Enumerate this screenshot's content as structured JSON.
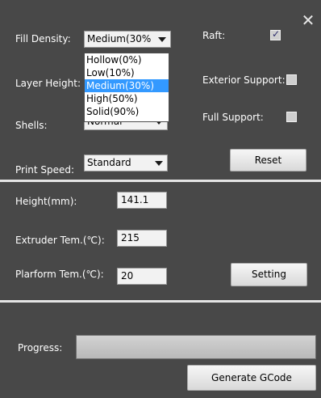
{
  "fill_density": {
    "label": "Fill Density:",
    "selected": "Medium(30%",
    "options": [
      "Hollow(0%)",
      "Low(10%)",
      "Medium(30%)",
      "High(50%)",
      "Solid(90%)"
    ],
    "highlighted_index": 2
  },
  "layer_height": {
    "label": "Layer Height:"
  },
  "shells": {
    "label": "Shells:",
    "selected": "Normal"
  },
  "print_speed": {
    "label": "Print Speed:",
    "selected": "Standard"
  },
  "raft": {
    "label": "Raft:",
    "checked": true
  },
  "exterior_support": {
    "label": "Exterior Support:",
    "checked": false
  },
  "full_support": {
    "label": "Full Support:",
    "checked": false
  },
  "reset_button": "Reset",
  "height": {
    "label": "Height(mm):",
    "value": "141.1"
  },
  "extruder_temp": {
    "label": "Extruder Tem.(℃):",
    "value": "215"
  },
  "platform_temp": {
    "label": "Plarform Tem.(℃):",
    "value": "20"
  },
  "setting_button": "Setting",
  "progress": {
    "label": "Progress:",
    "value": 0
  },
  "generate_button": "Generate GCode",
  "icons": {
    "close": "close-icon",
    "dropdown": "chevron-down-icon",
    "check": "checkmark-icon"
  }
}
